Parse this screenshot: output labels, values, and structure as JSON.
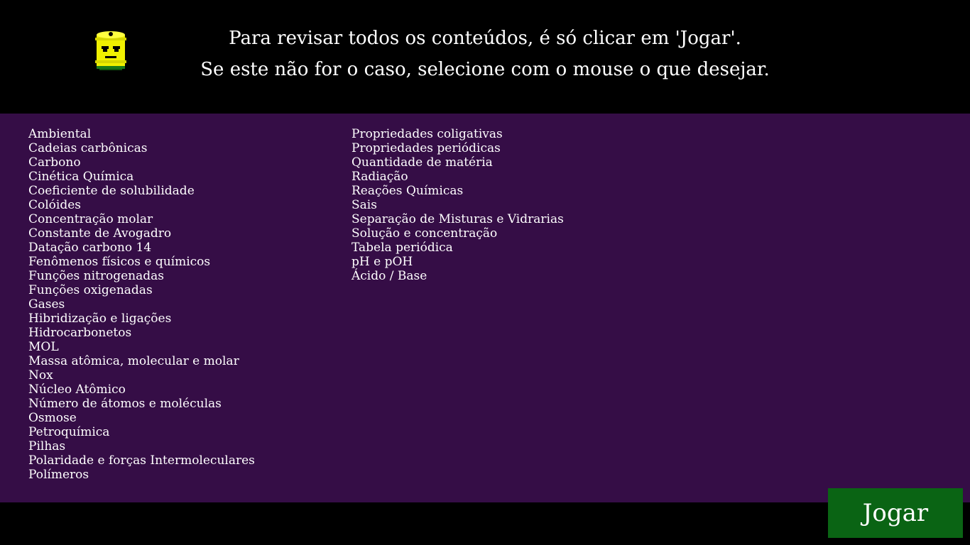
{
  "header": {
    "mascot_icon": "radioactive-barrel-icon",
    "instruction_line1": "Para revisar todos os conteúdos, é só clicar em 'Jogar'.",
    "instruction_line2": "Se este não for o caso, selecione com o mouse o que desejar."
  },
  "topics": {
    "left": [
      "Ambiental",
      "Cadeias carbônicas",
      "Carbono",
      "Cinética Química",
      "Coeficiente de solubilidade",
      "Colóides",
      "Concentração molar",
      "Constante de Avogadro",
      "Datação carbono 14",
      "Fenômenos físicos e químicos",
      "Funções nitrogenadas",
      "Funções oxigenadas",
      "Gases",
      "Hibridização e ligações",
      "Hidrocarbonetos",
      "MOL",
      "Massa atômica, molecular e molar",
      "Nox",
      "Núcleo Atômico",
      "Número de átomos e moléculas",
      "Osmose",
      "Petroquímica",
      "Pilhas",
      "Polaridade e forças Intermoleculares",
      "Polímeros"
    ],
    "right": [
      "Propriedades coligativas",
      "Propriedades periódicas",
      "Quantidade de matéria",
      "Radiação",
      "Reações Químicas",
      "Sais",
      "Separação de Misturas e Vidrarias",
      "Solução e concentração",
      "Tabela periódica",
      "pH e pOH",
      "Ácido / Base"
    ]
  },
  "play_button": {
    "label": "Jogar"
  },
  "colors": {
    "background": "#000000",
    "panel": "#350d46",
    "button": "#0a6414",
    "text": "#ffffff",
    "mascot": "#f0f000"
  }
}
